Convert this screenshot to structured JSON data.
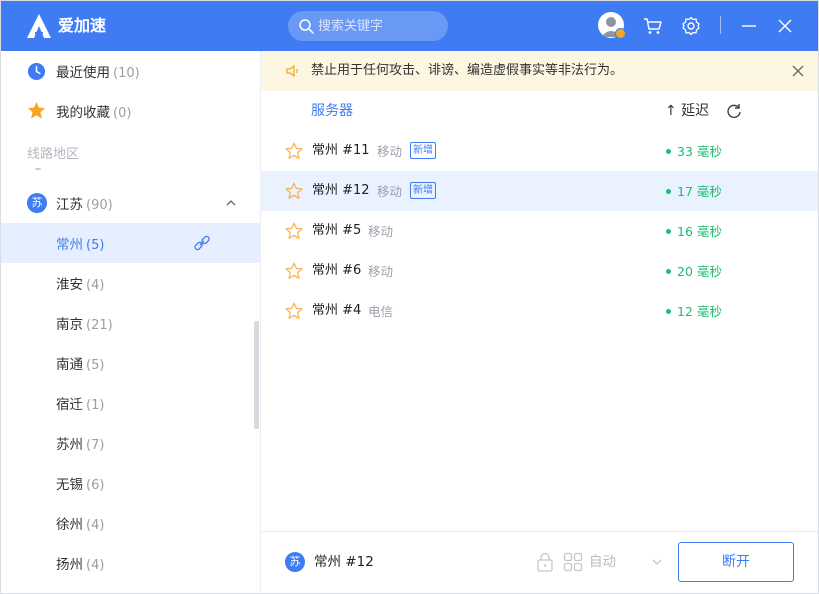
{
  "app": {
    "brand": "爱加速"
  },
  "search": {
    "placeholder": "搜索关键字"
  },
  "colors": {
    "accent": "#3f7bf2",
    "latency_good": "#1fbb6d",
    "notice_bg": "#fdf6e3",
    "star": "#f5a623"
  },
  "sidebar": {
    "recent": {
      "label": "最近使用",
      "count": "(10)",
      "icon": "clock-icon"
    },
    "favorites": {
      "label": "我的收藏",
      "count": "(0)",
      "icon": "star-icon"
    },
    "region_header": "线路地区",
    "province": {
      "badge": "苏",
      "label": "江苏",
      "count": "(90)",
      "expanded": true
    },
    "cities": [
      {
        "label": "常州",
        "count": "(5)",
        "active": true
      },
      {
        "label": "淮安",
        "count": "(4)"
      },
      {
        "label": "南京",
        "count": "(21)"
      },
      {
        "label": "南通",
        "count": "(5)"
      },
      {
        "label": "宿迁",
        "count": "(1)"
      },
      {
        "label": "苏州",
        "count": "(7)"
      },
      {
        "label": "无锡",
        "count": "(6)"
      },
      {
        "label": "徐州",
        "count": "(4)"
      },
      {
        "label": "扬州",
        "count": "(4)"
      }
    ]
  },
  "notice": {
    "text": "禁止用于任何攻击、诽谤、编造虚假事实等非法行为。"
  },
  "columns": {
    "server": "服务器",
    "latency": "↑ 延迟"
  },
  "servers": [
    {
      "name": "常州 #11",
      "isp": "移动",
      "badge": "新增",
      "latency": "33 毫秒",
      "selected": false
    },
    {
      "name": "常州 #12",
      "isp": "移动",
      "badge": "新增",
      "latency": "17 毫秒",
      "selected": true
    },
    {
      "name": "常州 #5",
      "isp": "移动",
      "badge": "",
      "latency": "16 毫秒",
      "selected": false
    },
    {
      "name": "常州 #6",
      "isp": "移动",
      "badge": "",
      "latency": "20 毫秒",
      "selected": false
    },
    {
      "name": "常州 #4",
      "isp": "电信",
      "badge": "",
      "latency": "12 毫秒",
      "selected": false
    }
  ],
  "bottom": {
    "badge": "苏",
    "current": "常州 #12",
    "mode": "自动",
    "disconnect_label": "断开"
  }
}
